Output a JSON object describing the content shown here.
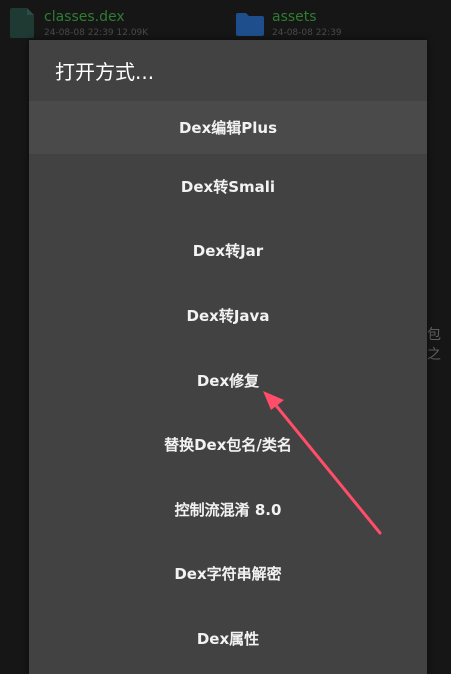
{
  "background_files": [
    {
      "name": "classes.dex",
      "meta": "24-08-08 22:39  12.09K",
      "icon": "file-icon"
    },
    {
      "name": "assets",
      "meta": "24-08-08 22:39",
      "icon": "folder-icon"
    }
  ],
  "background_fragment": "包之",
  "dialog": {
    "title": "打开方式...",
    "items": [
      {
        "label": "Dex编辑Plus"
      },
      {
        "label": "Dex转Smali"
      },
      {
        "label": "Dex转Jar"
      },
      {
        "label": "Dex转Java"
      },
      {
        "label": "Dex修复"
      },
      {
        "label": "替换Dex包名/类名"
      },
      {
        "label": "控制流混淆 8.0"
      },
      {
        "label": "Dex字符串解密"
      },
      {
        "label": "Dex属性"
      }
    ]
  },
  "colors": {
    "page_bg": "#161616",
    "dialog_bg": "#424242",
    "highlight_bg": "#4a4a4a",
    "filename_green": "#2e7d32",
    "folder_blue": "#1e4e8c",
    "annotation_arrow": "#ff4d6a"
  },
  "annotation": {
    "type": "arrow",
    "points_to": "Dex修复"
  }
}
